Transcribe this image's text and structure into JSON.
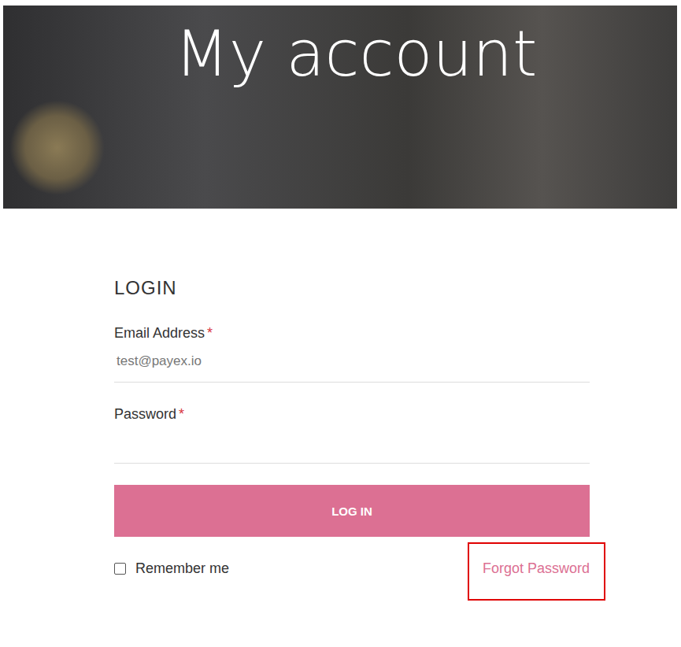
{
  "hero": {
    "title": "My account"
  },
  "form": {
    "heading": "LOGIN",
    "fields": [
      {
        "label": "Email Address",
        "required": true,
        "required_mark": "*",
        "value": "test@payex.io"
      },
      {
        "label": "Password",
        "required": true,
        "required_mark": "*",
        "value": ""
      }
    ],
    "submit": "LOG IN",
    "remember": {
      "label": "Remember me",
      "checked": false
    },
    "forgot": {
      "label": "Forgot Password",
      "highlighted": true
    }
  }
}
